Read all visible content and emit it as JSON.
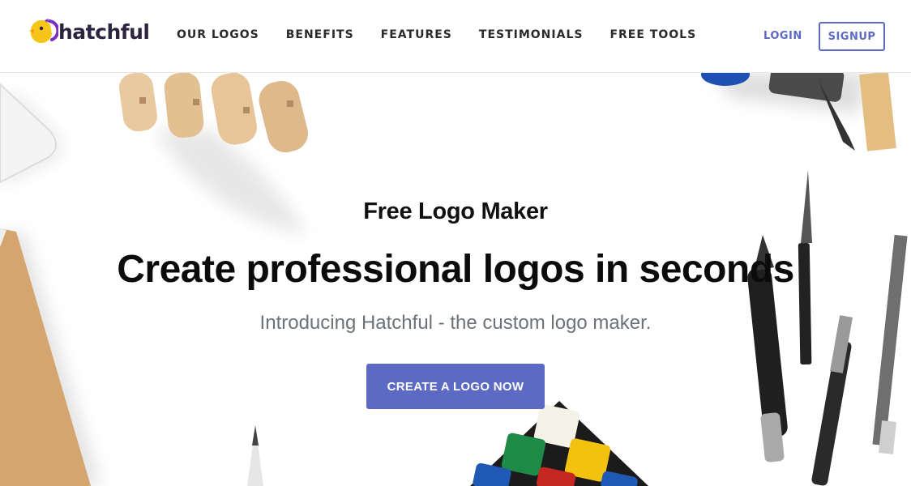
{
  "brand": {
    "name": "hatchful"
  },
  "nav": {
    "items": [
      {
        "label": "OUR LOGOS"
      },
      {
        "label": "BENEFITS"
      },
      {
        "label": "FEATURES"
      },
      {
        "label": "TESTIMONIALS"
      },
      {
        "label": "FREE TOOLS"
      }
    ],
    "login_label": "LOGIN",
    "signup_label": "SIGNUP"
  },
  "hero": {
    "eyebrow": "Free Logo Maker",
    "headline": "Create professional logos in seconds",
    "subheadline": "Introducing Hatchful - the custom logo maker.",
    "cta_label": "CREATE A LOGO NOW"
  },
  "colors": {
    "accent": "#5c6ac4",
    "brand_text": "#2d2440",
    "logo_yellow": "#f5c518",
    "logo_purple": "#7b2fbf"
  },
  "icons": {
    "brand_mark": "chick-logo-icon"
  }
}
